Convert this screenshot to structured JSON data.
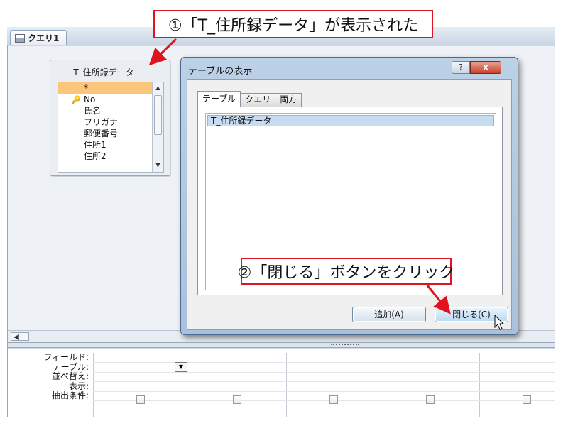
{
  "callouts": {
    "first": "①「T_住所録データ」が表示された",
    "second": "②「閉じる」ボタンをクリック"
  },
  "query_tab": {
    "label": "クエリ1"
  },
  "table_box": {
    "title": "T_住所録データ",
    "fields": [
      "*",
      "No",
      "氏名",
      "フリガナ",
      "郵便番号",
      "住所1",
      "住所2"
    ],
    "key_field": "No"
  },
  "dialog": {
    "title": "テーブルの表示",
    "help_label": "?",
    "close_label": "x",
    "tabs": [
      "テーブル",
      "クエリ",
      "両方"
    ],
    "active_tab": "テーブル",
    "list_items": [
      "T_住所録データ"
    ],
    "add_button": "追加(A)",
    "close_button": "閉じる(C)"
  },
  "design_grid": {
    "row_labels": [
      "フィールド:",
      "テーブル:",
      "並べ替え:",
      "表示:",
      "抽出条件:"
    ],
    "column_count": 5
  },
  "colors": {
    "accent_red": "#e0141e",
    "selection": "#c6dcf3",
    "field_highlight": "#fbc57a"
  }
}
